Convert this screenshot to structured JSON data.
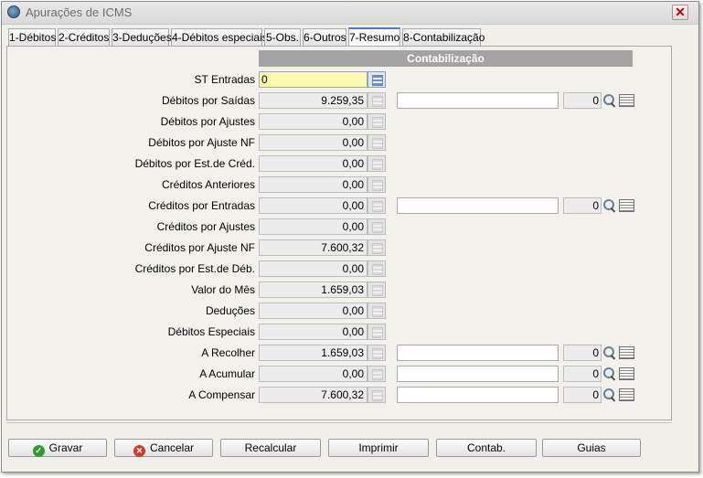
{
  "window": {
    "title": "Apurações de ICMS",
    "close_label": "✕"
  },
  "tabs": [
    {
      "label": "1-Débitos"
    },
    {
      "label": "2-Créditos"
    },
    {
      "label": "3-Deduções"
    },
    {
      "label": "4-Débitos especiais"
    },
    {
      "label": "5-Obs."
    },
    {
      "label": "6-Outros"
    },
    {
      "label": "7-Resumo"
    },
    {
      "label": "8-Contabilização"
    }
  ],
  "active_tab": "7-Resumo",
  "section": {
    "header": "Contabilização"
  },
  "rows": [
    {
      "label": "ST Entradas",
      "value": "0"
    },
    {
      "label": "Débitos por Saídas",
      "value": "9.259,35",
      "text": "",
      "num": "0"
    },
    {
      "label": "Débitos por Ajustes",
      "value": "0,00"
    },
    {
      "label": "Débitos por Ajuste NF",
      "value": "0,00"
    },
    {
      "label": "Débitos por Est.de Créd.",
      "value": "0,00"
    },
    {
      "label": "Créditos Anteriores",
      "value": "0,00"
    },
    {
      "label": "Créditos por Entradas",
      "value": "0,00",
      "text": "",
      "num": "0"
    },
    {
      "label": "Créditos por Ajustes",
      "value": "0,00"
    },
    {
      "label": "Créditos por Ajuste NF",
      "value": "7.600,32"
    },
    {
      "label": "Créditos por Est.de Déb.",
      "value": "0,00"
    },
    {
      "label": "Valor do Mês",
      "value": "1.659,03"
    },
    {
      "label": "Deduções",
      "value": "0,00"
    },
    {
      "label": "Débitos Especiais",
      "value": "0,00"
    },
    {
      "label": "A Recolher",
      "value": "1.659,03",
      "text": "",
      "num": "0"
    },
    {
      "label": "A Acumular",
      "value": "0,00",
      "text": "",
      "num": "0"
    },
    {
      "label": "A Compensar",
      "value": "7.600,32",
      "text": "",
      "num": "0"
    }
  ],
  "buttons": [
    {
      "label": "Gravar",
      "icon": "check-icon"
    },
    {
      "label": "Cancelar",
      "icon": "cancel-icon"
    },
    {
      "label": "Recalcular"
    },
    {
      "label": "Imprimir"
    },
    {
      "label": "Contab."
    },
    {
      "label": "Guias"
    }
  ],
  "colors": {
    "active_field": "#fff9b0",
    "header_bg": "#a3a3a3",
    "tab_accent": "#3f7fd6"
  }
}
